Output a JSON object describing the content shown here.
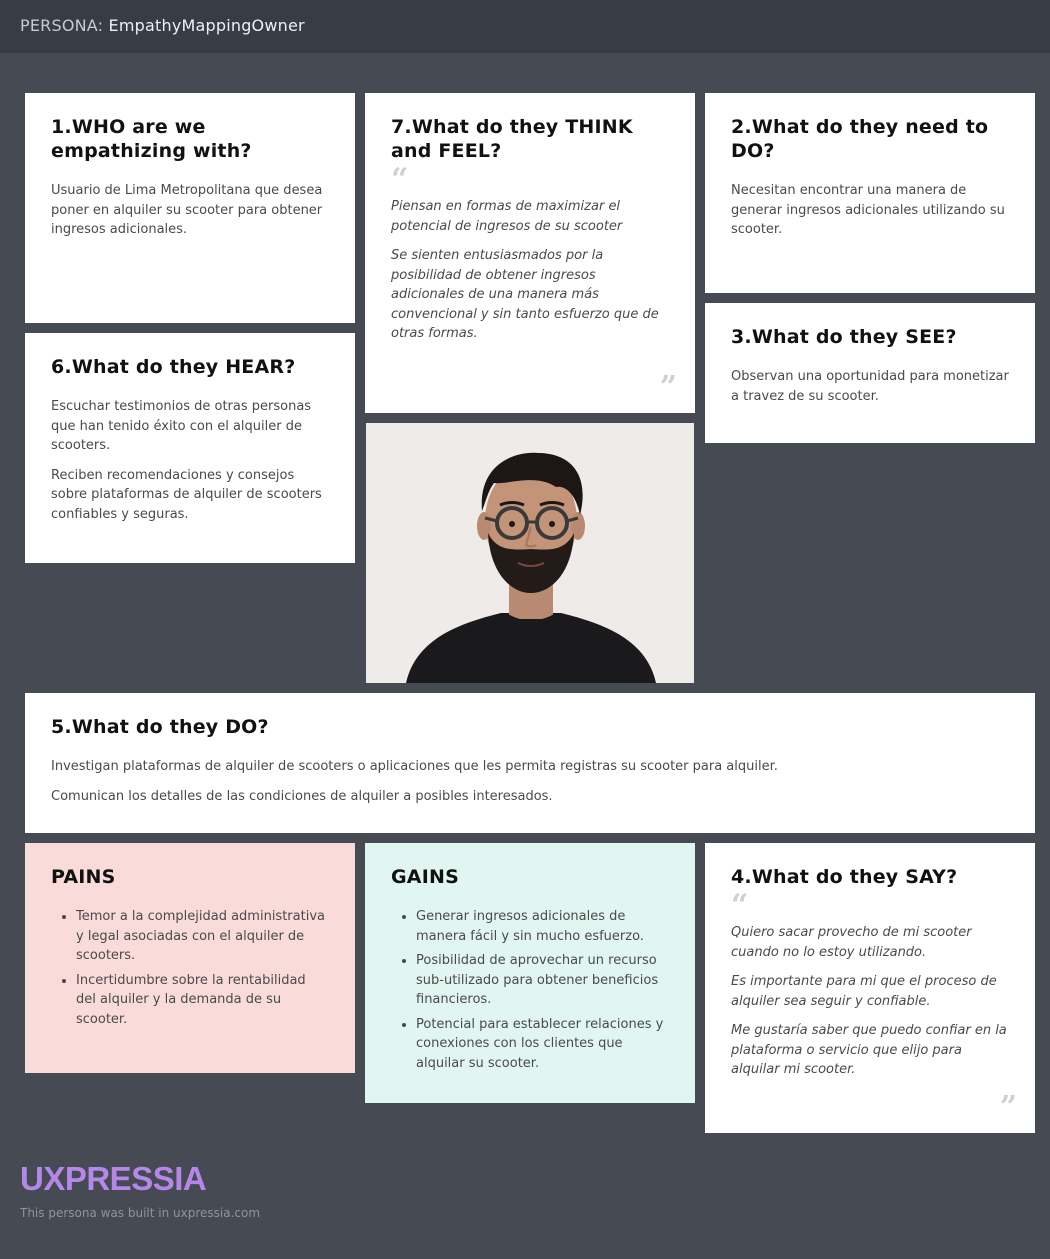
{
  "header": {
    "persona_label": "PERSONA:",
    "persona_name": "EmpathyMappingOwner"
  },
  "who": {
    "title": "1.WHO are we empathizing with?",
    "paragraphs": [
      "Usuario de Lima Metropolitana que desea poner en alquiler su scooter para obtener ingresos adicionales."
    ]
  },
  "need": {
    "title": "2.What do they need to DO?",
    "paragraphs": [
      "Necesitan encontrar una manera de generar ingresos adicionales utilizando su scooter."
    ]
  },
  "see": {
    "title": "3.What do they SEE?",
    "paragraphs": [
      "Observan una oportunidad para monetizar a travez de su scooter."
    ]
  },
  "say": {
    "title": "4.What do they SAY?",
    "quotes": [
      "Quiero sacar provecho de mi scooter cuando no lo estoy utilizando.",
      "Es importante para mi que el proceso de alquiler sea seguir y confiable.",
      "Me gustaría saber que puedo confiar en la plataforma o servicio que elijo para alquilar mi scooter."
    ]
  },
  "do": {
    "title": "5.What do they DO?",
    "paragraphs": [
      "Investigan plataformas de alquiler de scooters o aplicaciones que les permita registras su scooter para alquiler.",
      "Comunican los detalles de las condiciones de alquiler a posibles interesados."
    ]
  },
  "hear": {
    "title": "6.What do they HEAR?",
    "paragraphs": [
      "Escuchar testimonios de otras personas que han tenido éxito con el alquiler de scooters.",
      "Reciben recomendaciones y consejos sobre plataformas de alquiler de scooters confiables y seguras."
    ]
  },
  "think": {
    "title": "7.What do they THINK and FEEL?",
    "quotes": [
      "Piensan en formas de maximizar el potencial de ingresos de su scooter",
      "Se sienten entusiasmados por la posibilidad de obtener ingresos adicionales de una manera más convencional y sin tanto esfuerzo que de otras formas."
    ]
  },
  "pains": {
    "title": "PAINS",
    "items": [
      "Temor a la complejidad administrativa y legal asociadas con el alquiler de scooters.",
      "Incertidumbre sobre la rentabilidad del alquiler y la demanda de su scooter."
    ]
  },
  "gains": {
    "title": "GAINS",
    "items": [
      "Generar ingresos adicionales de manera fácil y sin mucho esfuerzo.",
      "Posibilidad de aprovechar un recurso sub-utilizado para obtener beneficios financieros.",
      "Potencial para establecer relaciones y conexiones con los clientes que alquilar su scooter."
    ]
  },
  "footer": {
    "logo": "UXPRESSIA",
    "note": "This persona was built in uxpressia.com"
  },
  "colors": {
    "background": "#464a52",
    "header": "#383c44",
    "pains_bg": "#f9dcd9",
    "gains_bg": "#e2f6f1",
    "logo": "#b487e8"
  }
}
